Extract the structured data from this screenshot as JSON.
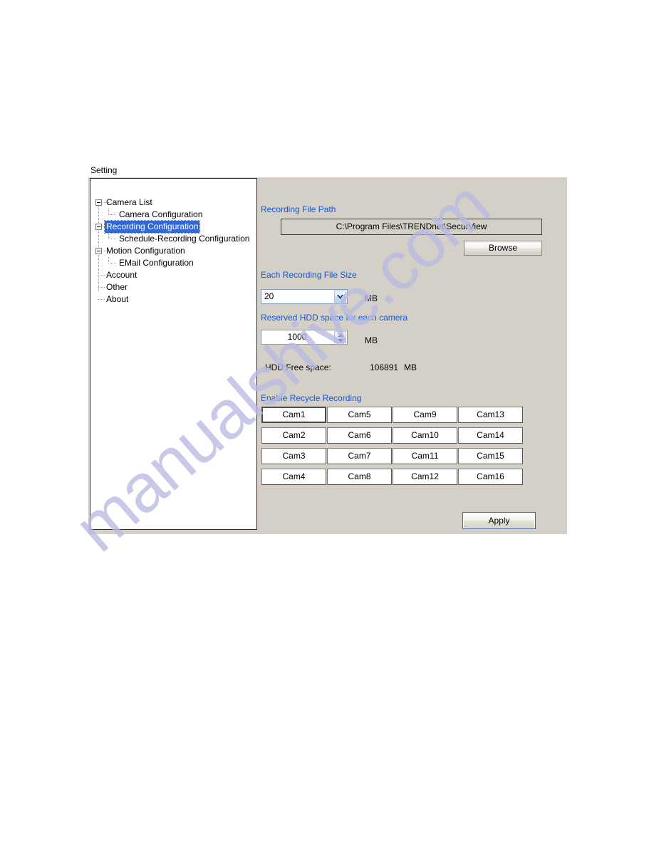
{
  "watermark": {
    "text": "manualshive.com",
    "color": "#b9b9e4"
  },
  "dialog": {
    "title": "Setting"
  },
  "tree": {
    "items": [
      {
        "label": "Camera List",
        "level": 0,
        "expander": true,
        "selected": false
      },
      {
        "label": "Camera Configuration",
        "level": 1,
        "expander": false,
        "selected": false
      },
      {
        "label": "Recording Configuration",
        "level": 0,
        "expander": true,
        "selected": true
      },
      {
        "label": "Schedule-Recording Configuration",
        "level": 1,
        "expander": false,
        "selected": false
      },
      {
        "label": "Motion Configuration",
        "level": 0,
        "expander": true,
        "selected": false
      },
      {
        "label": "EMail Configuration",
        "level": 1,
        "expander": false,
        "selected": false
      },
      {
        "label": "Account",
        "level": 0,
        "expander": false,
        "selected": false
      },
      {
        "label": "Other",
        "level": 0,
        "expander": false,
        "selected": false
      },
      {
        "label": "About",
        "level": 0,
        "expander": false,
        "selected": false
      }
    ]
  },
  "recording": {
    "file_path_label": "Recording File Path",
    "file_path_value": "C:\\Program Files\\TRENDnet\\SecurView",
    "browse_label": "Browse",
    "file_size_label": "Each Recording File Size",
    "file_size_value": "20",
    "file_size_unit": "MB",
    "reserved_label": "Reserved HDD space for each camera",
    "reserved_value": "1000",
    "reserved_unit": "MB",
    "free_space_label": "HDD Free space:",
    "free_space_value": "106891",
    "free_space_unit": "MB",
    "recycle_label": "Enable Recycle Recording",
    "apply_label": "Apply"
  },
  "cameras": [
    {
      "label": "Cam1",
      "col": 0,
      "row": 0,
      "focused": true
    },
    {
      "label": "Cam2",
      "col": 0,
      "row": 1,
      "focused": false
    },
    {
      "label": "Cam3",
      "col": 0,
      "row": 2,
      "focused": false
    },
    {
      "label": "Cam4",
      "col": 0,
      "row": 3,
      "focused": false
    },
    {
      "label": "Cam5",
      "col": 1,
      "row": 0,
      "focused": false
    },
    {
      "label": "Cam6",
      "col": 1,
      "row": 1,
      "focused": false
    },
    {
      "label": "Cam7",
      "col": 1,
      "row": 2,
      "focused": false
    },
    {
      "label": "Cam8",
      "col": 1,
      "row": 3,
      "focused": false
    },
    {
      "label": "Cam9",
      "col": 2,
      "row": 0,
      "focused": false
    },
    {
      "label": "Cam10",
      "col": 2,
      "row": 1,
      "focused": false
    },
    {
      "label": "Cam11",
      "col": 2,
      "row": 2,
      "focused": false
    },
    {
      "label": "Cam12",
      "col": 2,
      "row": 3,
      "focused": false
    },
    {
      "label": "Cam13",
      "col": 3,
      "row": 0,
      "focused": false
    },
    {
      "label": "Cam14",
      "col": 3,
      "row": 1,
      "focused": false
    },
    {
      "label": "Cam15",
      "col": 3,
      "row": 2,
      "focused": false
    },
    {
      "label": "Cam16",
      "col": 3,
      "row": 3,
      "focused": false
    }
  ]
}
